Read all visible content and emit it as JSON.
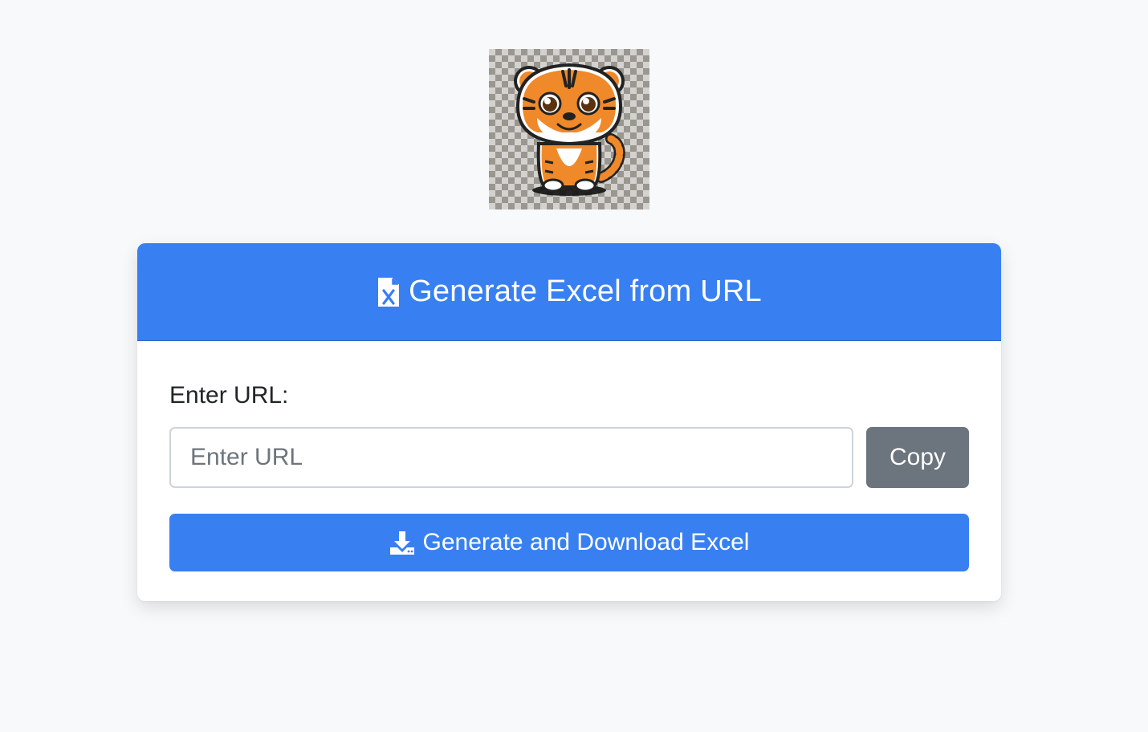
{
  "logo": {
    "icon": "tiger-mascot-icon"
  },
  "card": {
    "header": {
      "icon": "file-excel-icon",
      "title": "Generate Excel from URL"
    },
    "form": {
      "url_label": "Enter URL:",
      "url_input": {
        "value": "",
        "placeholder": "Enter URL"
      },
      "copy_button_label": "Copy",
      "generate_button": {
        "icon": "download-icon",
        "label": "Generate and Download Excel"
      }
    }
  },
  "colors": {
    "background": "#f8f9fa",
    "primary": "#3880f2",
    "secondary": "#6c757d",
    "card": "#ffffff"
  }
}
